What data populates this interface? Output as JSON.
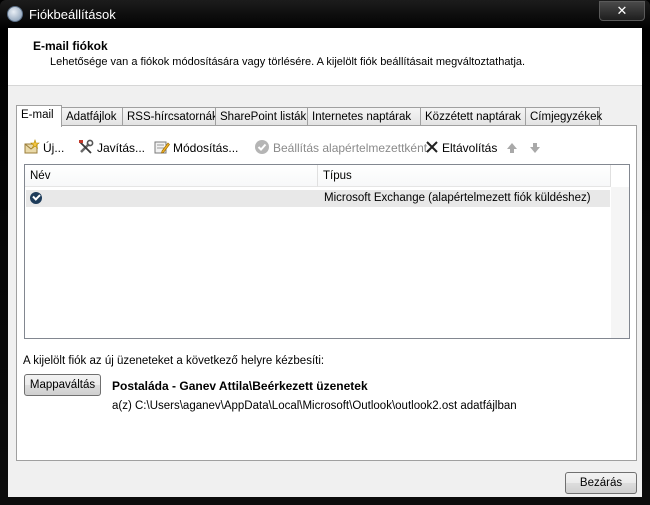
{
  "window": {
    "title": "Fiókbeállítások",
    "close_symbol": "✕"
  },
  "header": {
    "title": "E-mail fiókok",
    "description": "Lehetősége van a fiókok módosítására vagy törlésére. A kijelölt fiók beállításait megváltoztathatja."
  },
  "tabs": [
    {
      "label": "E-mail"
    },
    {
      "label": "Adatfájlok"
    },
    {
      "label": "RSS-hírcsatornák"
    },
    {
      "label": "SharePoint listák"
    },
    {
      "label": "Internetes naptárak"
    },
    {
      "label": "Közzétett naptárak"
    },
    {
      "label": "Címjegyzékek"
    }
  ],
  "toolbar": {
    "new_label": "Új...",
    "repair_label": "Javítás...",
    "change_label": "Módosítás...",
    "set_default_label": "Beállítás alapértelmezettként",
    "remove_label": "Eltávolítás"
  },
  "list": {
    "columns": [
      "Név",
      "Típus"
    ],
    "rows": [
      {
        "name": "",
        "type": "Microsoft Exchange (alapértelmezett fiók küldéshez)"
      }
    ]
  },
  "delivery": {
    "caption": "A kijelölt fiók az új üzeneteket a következő helyre kézbesíti:",
    "change_folder_label": "Mappaváltás",
    "folder": "Postaláda - Ganev Attila\\Beérkezett üzenetek",
    "path": "a(z) C:\\Users\\aganev\\AppData\\Local\\Microsoft\\Outlook\\outlook2.ost adatfájlban"
  },
  "footer": {
    "close_label": "Bezárás"
  }
}
